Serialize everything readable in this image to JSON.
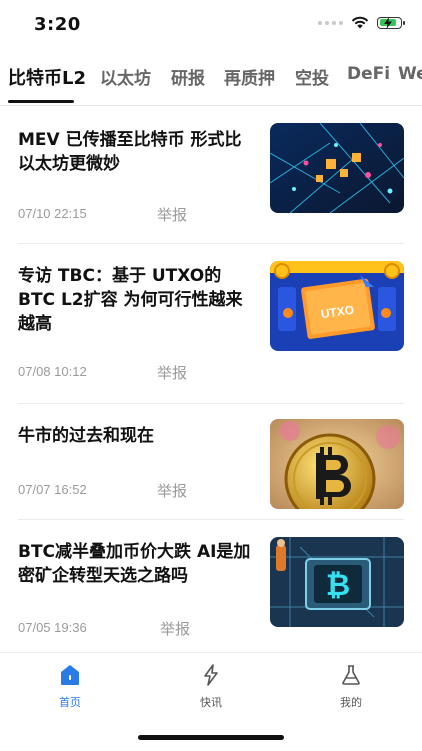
{
  "status_bar": {
    "time": "3:20"
  },
  "tabs": [
    {
      "label": "比特币L2",
      "active": true
    },
    {
      "label": "以太坊"
    },
    {
      "label": "研报"
    },
    {
      "label": "再质押"
    },
    {
      "label": "空投"
    },
    {
      "label": "DeFi"
    },
    {
      "label": "We"
    }
  ],
  "articles": [
    {
      "title": "MEV 已传播至比特币 形式比以太坊更微妙",
      "date": "07/10 22:15",
      "report": "举报",
      "thumb": "circuit-network-image"
    },
    {
      "title": "专访 TBC：基于 UTXO的BTC L2扩容 为何可行性越来越高",
      "date": "07/08 10:12",
      "report": "举报",
      "thumb": "utxo-illustration",
      "thumb_text": "UTXO"
    },
    {
      "title": "牛市的过去和现在",
      "date": "07/07 16:52",
      "report": "举报",
      "thumb": "bitcoin-coin-image"
    },
    {
      "title": "BTC减半叠加币价大跌 AI是加密矿企转型天选之路吗",
      "date": "07/05 19:36",
      "report": "举报",
      "thumb": "bitcoin-chip-image"
    }
  ],
  "bottom_nav": [
    {
      "label": "首页",
      "icon": "home-icon",
      "active": true
    },
    {
      "label": "快讯",
      "icon": "lightning-icon"
    },
    {
      "label": "我的",
      "icon": "flask-icon"
    }
  ],
  "colors": {
    "accent": "#2a7be4",
    "battery": "#34c759"
  }
}
